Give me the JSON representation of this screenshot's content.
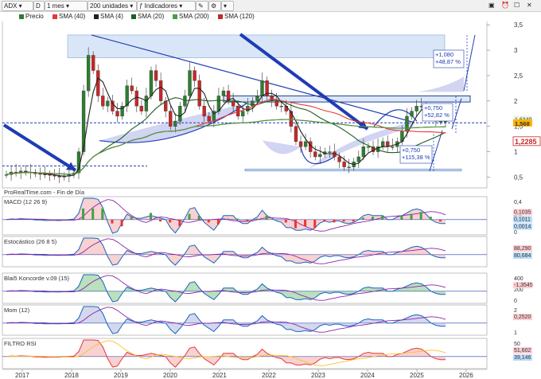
{
  "toolbar": {
    "symbol": "ADX",
    "period_letter": "D",
    "timeframe": "1 mes",
    "units": "200 unidades",
    "indicators": "Indicadores"
  },
  "legend": [
    {
      "label": "Precio",
      "color": "#2e7d32"
    },
    {
      "label": "SMA (40)",
      "color": "#e53935"
    },
    {
      "label": "SMA (4)",
      "color": "#212121"
    },
    {
      "label": "SMA (20)",
      "color": "#1b5e20"
    },
    {
      "label": "SMA (200)",
      "color": "#43a047"
    },
    {
      "label": "SMA (120)",
      "color": "#c62828"
    }
  ],
  "source": "ProRealTime.com - Fin de Día",
  "annotations": {
    "target_high": "+1,080\n+48,87 %",
    "target_mid": "+0,750\n+52,82 %",
    "target_low": "+0,750\n+115,38 %"
  },
  "price_badges": {
    "top": "1,6340",
    "mid": "1,568",
    "last": "1,2285"
  },
  "chart_data": [
    {
      "type": "candlestick",
      "name": "ADX monthly",
      "x_ticks": [
        "2017",
        "2018",
        "2019",
        "2020",
        "2021",
        "2022",
        "2023",
        "2024",
        "2025",
        "2026"
      ],
      "y_ticks": [
        0.5,
        1,
        1.5,
        2,
        2.5,
        3,
        3.5
      ],
      "ylim": [
        0.35,
        3.55
      ],
      "closes": [
        0.55,
        0.6,
        0.58,
        0.62,
        0.6,
        0.58,
        0.57,
        0.56,
        0.55,
        0.54,
        0.52,
        0.5,
        0.52,
        0.55,
        0.58,
        1.0,
        2.2,
        2.9,
        2.6,
        2.1,
        1.9,
        2.0,
        1.8,
        1.7,
        1.9,
        2.3,
        2.2,
        1.9,
        1.8,
        2.1,
        2.6,
        2.4,
        2.0,
        1.8,
        1.5,
        1.6,
        1.9,
        2.1,
        2.6,
        2.4,
        1.9,
        1.7,
        1.6,
        1.8,
        2.1,
        2.2,
        2.0,
        1.9,
        1.7,
        1.8,
        1.9,
        2.0,
        2.1,
        2.4,
        2.1,
        2.0,
        1.9,
        1.9,
        1.8,
        1.5,
        1.2,
        1.1,
        1.2,
        1.0,
        0.9,
        0.95,
        1.0,
        1.0,
        0.9,
        0.8,
        0.7,
        0.7,
        0.8,
        0.9,
        1.1,
        1.1,
        1.0,
        1.1,
        1.2,
        1.1,
        1.1,
        1.2,
        1.4,
        1.7,
        1.8,
        1.9,
        1.9,
        1.8,
        1.7,
        1.6,
        1.6,
        1.6
      ],
      "sma_series": [
        "SMA (4)",
        "SMA (20)",
        "SMA (40)",
        "SMA (120)",
        "SMA (200)"
      ]
    },
    {
      "type": "bar",
      "name": "MACD (12 26 9)",
      "y_ticks": [
        0.4,
        0.2,
        0.0
      ],
      "last_values": [
        "0,1035",
        "0,1011",
        "0,0014"
      ]
    },
    {
      "type": "line",
      "name": "Estocástico (26 8 5)",
      "last_values": [
        "88,290",
        "80,684"
      ]
    },
    {
      "type": "area",
      "name": "Blai5 Koncorde v.09 (15)",
      "y_ticks": [
        400,
        200,
        0
      ],
      "last_values": [
        "-1,3545"
      ]
    },
    {
      "type": "area",
      "name": "Mom (12)",
      "y_ticks": [
        2,
        1
      ],
      "last_values": [
        "0,2520"
      ]
    },
    {
      "type": "area",
      "name": "FILTRO RSI",
      "y_ticks": [
        50
      ],
      "last_values": [
        "51,602",
        "39,146"
      ]
    }
  ]
}
